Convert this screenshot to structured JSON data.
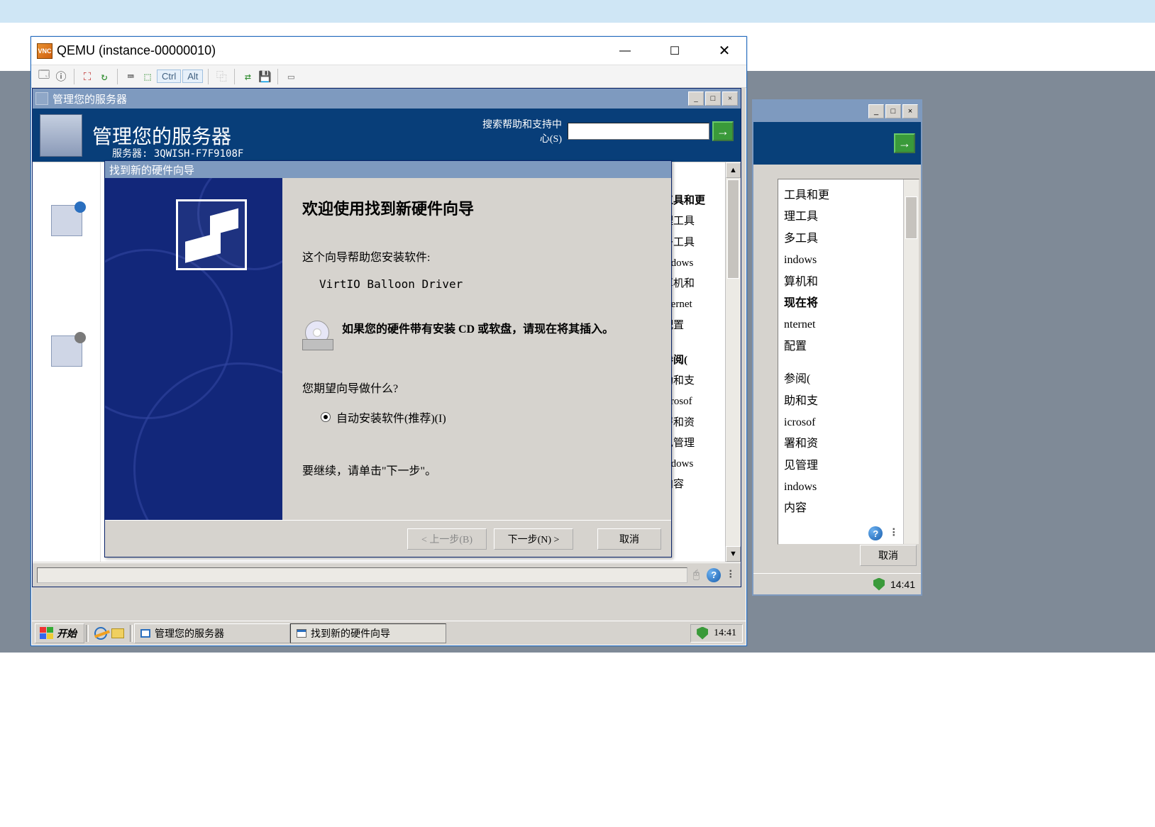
{
  "qemu": {
    "title": "QEMU (instance-00000010)",
    "ctrl": "Ctrl",
    "alt": "Alt"
  },
  "mgr": {
    "title": "管理您的服务器",
    "header_title": "管理您的服务器",
    "server_label_prefix": "服务器:",
    "server_name": "3QWISH-F7F9108F",
    "search_label": "搜索帮助和支持中心(S)",
    "right_header": "工具和更",
    "right_items": [
      "理工具",
      "多工具",
      "indows",
      "算机和",
      "nternet",
      "配置"
    ],
    "right_header2": "参阅(",
    "right_items2": [
      "助和支",
      "icrosof",
      "署和资",
      "见管理",
      "indows",
      "内容"
    ]
  },
  "bg": {
    "right_header": "工具和更",
    "right_items": [
      "理工具",
      "多工具",
      "indows",
      "算机和",
      "nternet",
      "配置"
    ],
    "right_header2": "参阅(",
    "right_items2": [
      "助和支",
      "icrosof",
      "署和资",
      "见管理",
      "indows",
      "内容"
    ],
    "cancel": "取消",
    "time": "14:41",
    "hint": "现在将"
  },
  "wizard": {
    "title": "找到新的硬件向导",
    "welcome": "欢迎使用找到新硬件向导",
    "help_line": "这个向导帮助您安装软件:",
    "driver": "VirtIO Balloon Driver",
    "cd_msg": "如果您的硬件带有安装 CD 或软盘，请现在将其插入。",
    "question": "您期望向导做什么?",
    "radio1": "自动安装软件(推荐)(I)",
    "continue": "要继续，请单击\"下一步\"。",
    "back": "< 上一步(B)",
    "next": "下一步(N) >",
    "cancel": "取消"
  },
  "taskbar": {
    "start": "开始",
    "task1": "管理您的服务器",
    "task2": "找到新的硬件向导",
    "time": "14:41"
  }
}
